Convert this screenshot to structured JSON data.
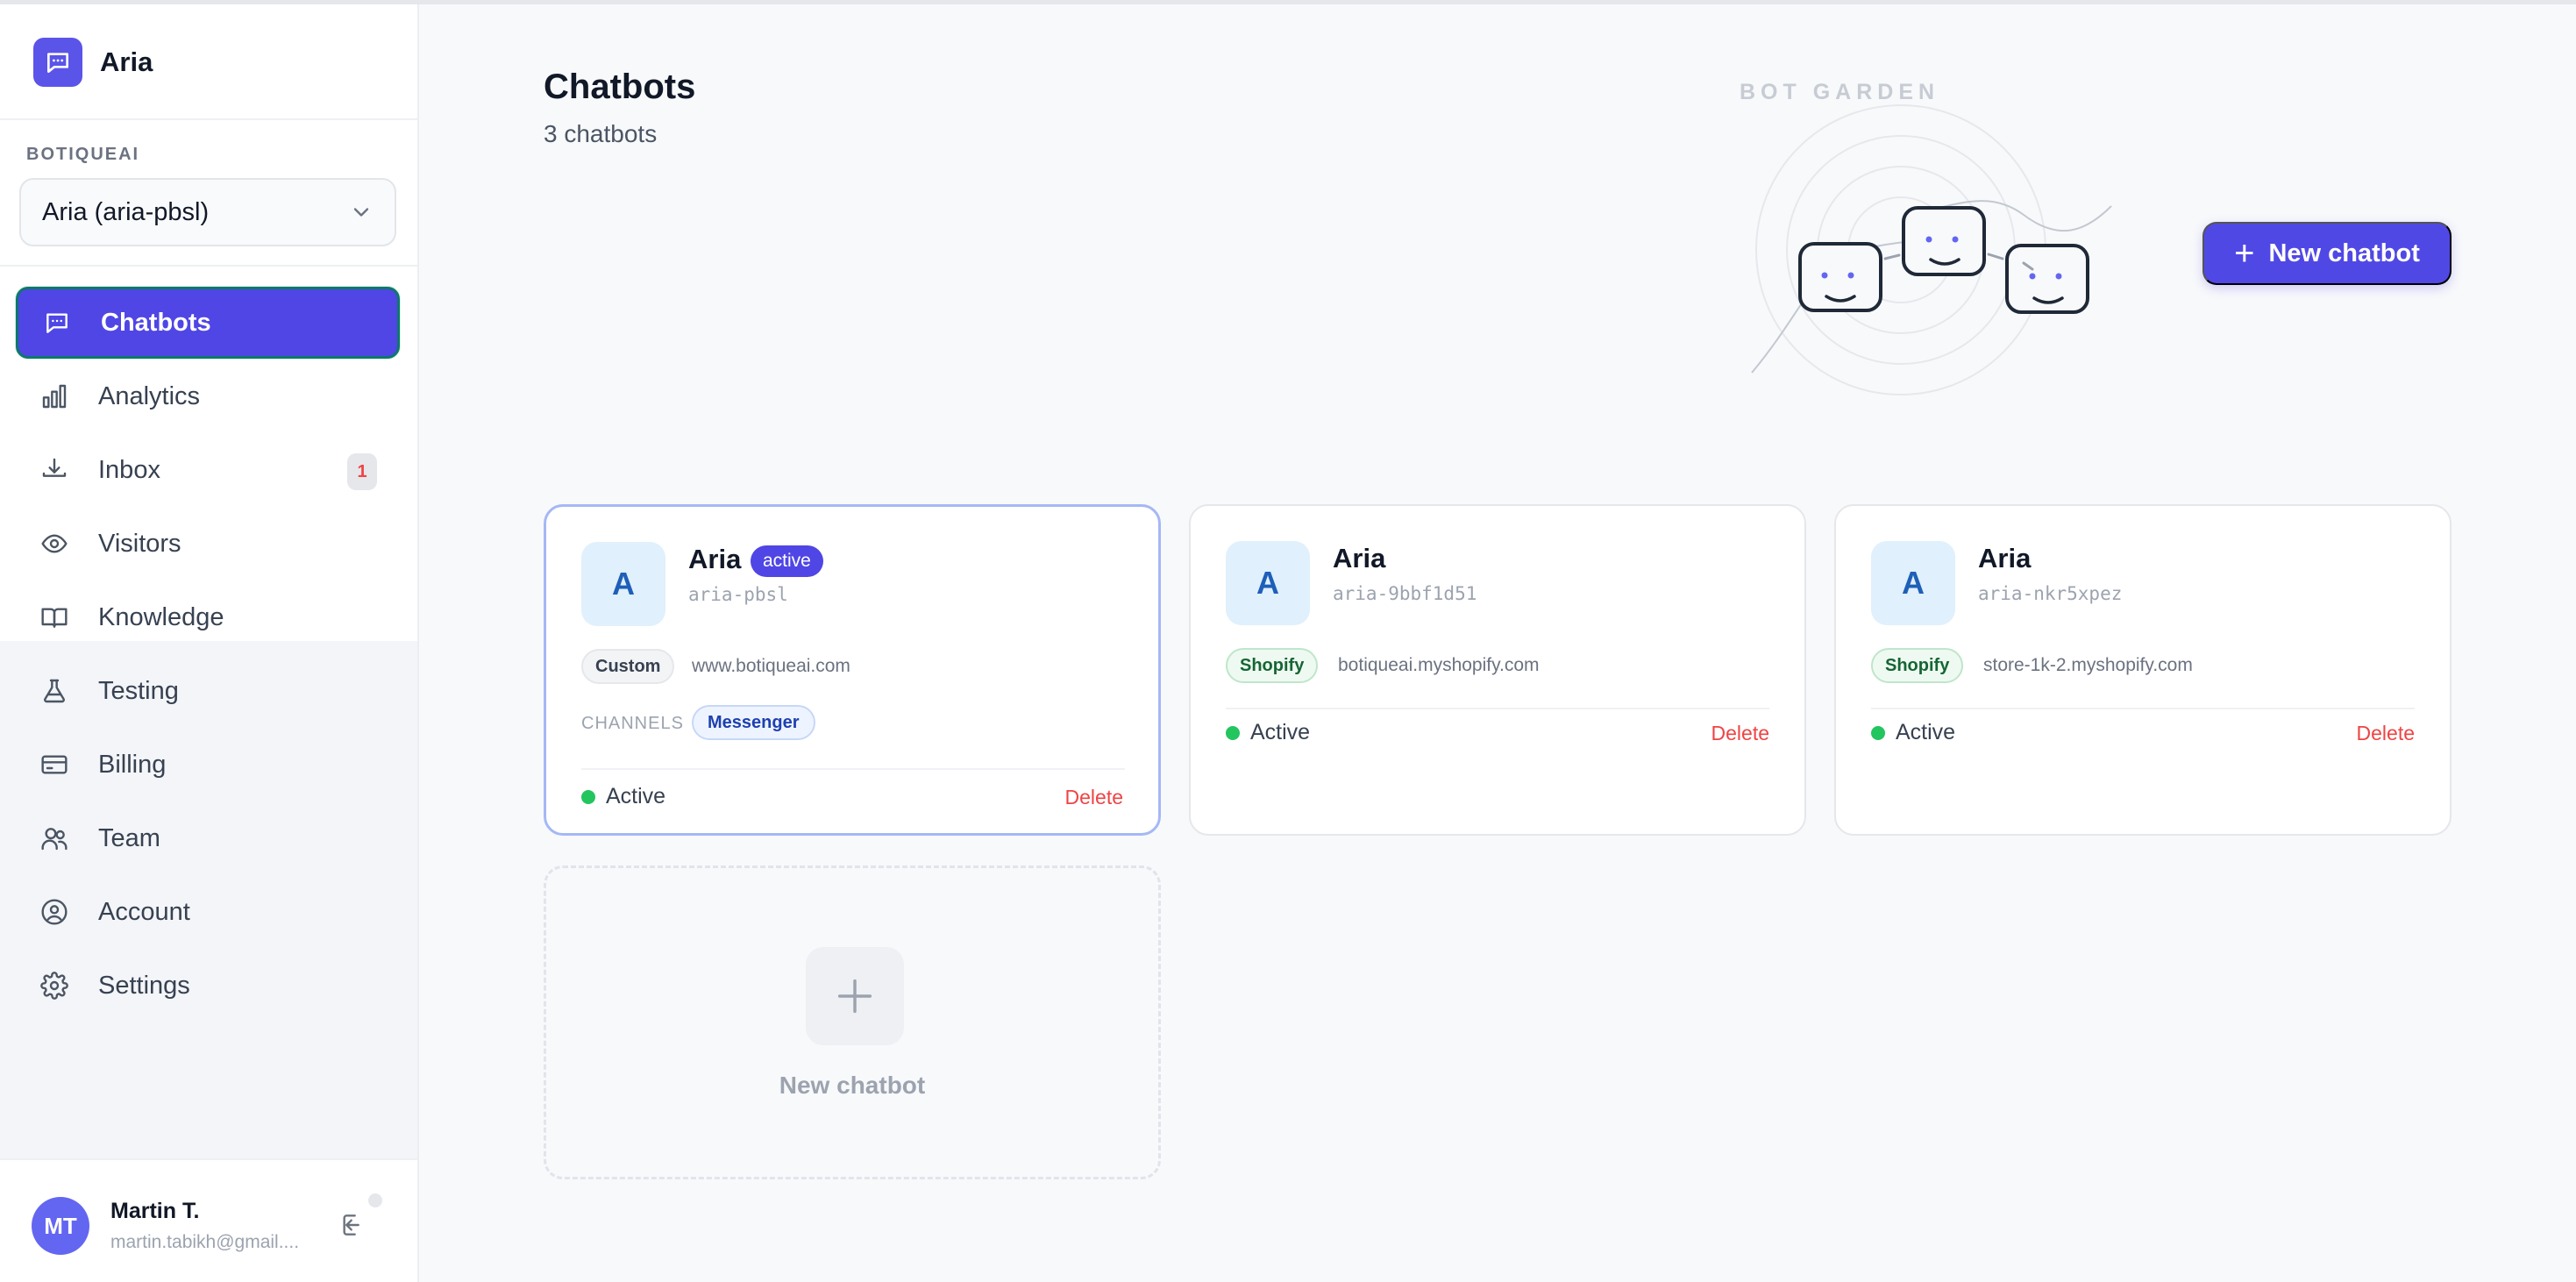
{
  "brand": {
    "name": "Aria"
  },
  "workspace": {
    "label": "BOTIQUEAI",
    "selected_bot": "Aria (aria-pbsl)"
  },
  "nav": {
    "items": [
      {
        "label": "Chatbots",
        "icon": "chat-icon",
        "active": true
      },
      {
        "label": "Analytics",
        "icon": "bar-chart-icon"
      },
      {
        "label": "Inbox",
        "icon": "inbox-icon",
        "badge": "1"
      },
      {
        "label": "Visitors",
        "icon": "eye-icon"
      },
      {
        "label": "Knowledge",
        "icon": "book-icon"
      },
      {
        "label": "Testing",
        "icon": "flask-icon"
      },
      {
        "label": "Billing",
        "icon": "credit-card-icon"
      },
      {
        "label": "Team",
        "icon": "users-icon"
      },
      {
        "label": "Account",
        "icon": "user-circle-icon"
      },
      {
        "label": "Settings",
        "icon": "gear-icon"
      }
    ]
  },
  "user": {
    "initials": "MT",
    "name": "Martin T.",
    "email": "martin.tabikh@gmail...."
  },
  "page": {
    "title": "Chatbots",
    "subtitle": "3 chatbots",
    "hero_label": "BOT GARDEN",
    "new_button": "New chatbot"
  },
  "cards": [
    {
      "initial": "A",
      "name": "Aria",
      "badge": "active",
      "slug": "aria-pbsl",
      "platform": "Custom",
      "domain": "www.botiqueai.com",
      "channels_label": "CHANNELS",
      "channel": "Messenger",
      "status": "Active",
      "delete": "Delete"
    },
    {
      "initial": "A",
      "name": "Aria",
      "slug": "aria-9bbf1d51",
      "platform": "Shopify",
      "domain": "botiqueai.myshopify.com",
      "status": "Active",
      "delete": "Delete"
    },
    {
      "initial": "A",
      "name": "Aria",
      "slug": "aria-nkr5xpez",
      "platform": "Shopify",
      "domain": "store-1k-2.myshopify.com",
      "status": "Active",
      "delete": "Delete"
    }
  ],
  "new_card": {
    "label": "New chatbot"
  },
  "colors": {
    "accent": "#4f46e5",
    "status_active": "#22c55e",
    "danger": "#ef4444"
  }
}
